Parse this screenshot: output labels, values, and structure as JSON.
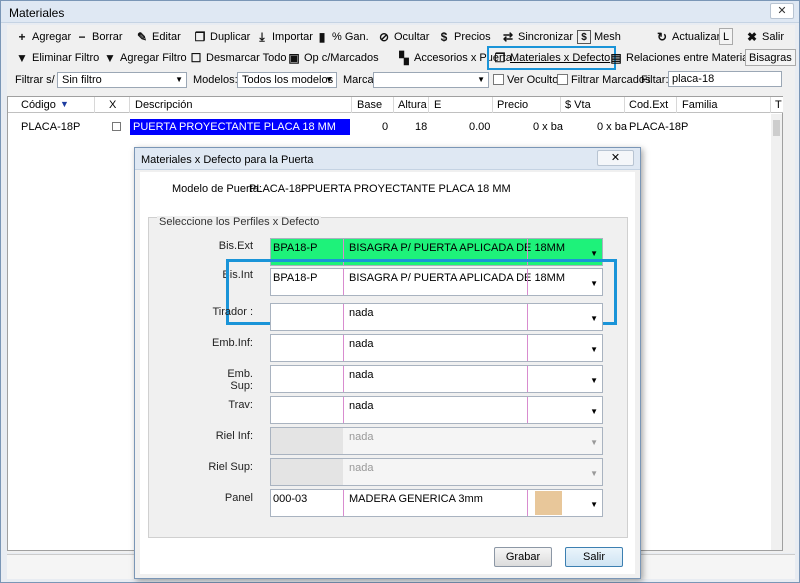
{
  "window": {
    "title": "Materiales",
    "close": "✕"
  },
  "toolbar1": [
    {
      "label": "Agregar",
      "icon": "plus-icon",
      "glyph": "+"
    },
    {
      "label": "Borrar",
      "icon": "minus-icon",
      "glyph": "−"
    },
    {
      "label": "Editar",
      "icon": "edit-icon",
      "glyph": "✎"
    },
    {
      "label": "Duplicar",
      "icon": "duplicate-icon",
      "glyph": "❐"
    },
    {
      "label": "Importar",
      "icon": "import-icon",
      "glyph": "⤓"
    },
    {
      "label": "% Gan.",
      "icon": "chart-icon",
      "glyph": "▮"
    },
    {
      "label": "Ocultar",
      "icon": "hide-icon",
      "glyph": "⊘"
    },
    {
      "label": "Precios",
      "icon": "dollar-icon",
      "glyph": "$"
    },
    {
      "label": "Sincronizar",
      "icon": "sync-icon",
      "glyph": "⇄"
    },
    {
      "label": "Mesh",
      "icon": "mesh-icon",
      "glyph": "$"
    },
    {
      "label": "Actualizar",
      "icon": "refresh-icon",
      "glyph": "↻"
    },
    {
      "label": "L",
      "icon": "",
      "glyph": ""
    },
    {
      "label": "Salir",
      "icon": "exit-icon",
      "glyph": "✖"
    }
  ],
  "toolbar2": [
    {
      "label": "Eliminar Filtro",
      "icon": "filter-remove-icon",
      "glyph": "▼"
    },
    {
      "label": "Agregar Filtro",
      "icon": "filter-add-icon",
      "glyph": "▼"
    },
    {
      "label": "Desmarcar Todo",
      "icon": "checkbox-icon",
      "glyph": "☐"
    },
    {
      "label": "Op c/Marcados",
      "icon": "ops-icon",
      "glyph": "▣"
    },
    {
      "label": "Accesorios x Puerta",
      "icon": "accessories-icon",
      "glyph": "▚"
    },
    {
      "label": "Materiales x Defecto",
      "icon": "materials-icon",
      "glyph": "❐"
    },
    {
      "label": "Relaciones entre Materiales",
      "icon": "relations-icon",
      "glyph": "▤"
    },
    {
      "label": "Bisagras",
      "icon": "",
      "glyph": ""
    }
  ],
  "filters": {
    "filtrar_label": "Filtrar s/ :",
    "filtrar_value": "Sin filtro",
    "modelos_label": "Modelos:",
    "modelos_value": "Todos los modelos",
    "marca_label": "Marca",
    "marca_value": "",
    "ver_ocultos": "Ver Ocultos",
    "filtrar_marcados": "Filtrar Marcados",
    "filtar_label": "Filtar:",
    "filtar_value": "placa-18"
  },
  "grid": {
    "columns": [
      "Código",
      "X",
      "Descripción",
      "Base",
      "Altura",
      "E",
      "Precio",
      "$ Vta",
      "Cod.Ext",
      "Familia",
      "T"
    ],
    "rows": [
      {
        "codigo": "PLACA-18P",
        "descripcion": "PUERTA PROYECTANTE PLACA 18 MM",
        "base": "0",
        "altura": "18",
        "e": "0.00",
        "precio": "0 x ba",
        "vta": "0 x ba",
        "codext": "PLACA-18P",
        "familia": ""
      }
    ]
  },
  "dialog": {
    "title": "Materiales x Defecto para la Puerta",
    "close": "✕",
    "modelo_label": "Modelo de Puerta:",
    "modelo_code": "PLACA-18P",
    "modelo_desc": "- PUERTA PROYECTANTE PLACA 18 MM",
    "group_label": "Seleccione los Perfiles x Defecto",
    "rows": [
      {
        "label": "Bis.Ext",
        "code": "BPA18-P",
        "desc": "BISAGRA P/ PUERTA APLICADA DE 18MM"
      },
      {
        "label": "Bis.Int",
        "code": "BPA18-P",
        "desc": "BISAGRA P/ PUERTA APLICADA DE 18MM"
      },
      {
        "label": "Tirador :",
        "code": "",
        "desc": "nada"
      },
      {
        "label": "Emb.Inf:",
        "code": "",
        "desc": "nada"
      },
      {
        "label": "Emb. Sup:",
        "code": "",
        "desc": "nada"
      },
      {
        "label": "Trav:",
        "code": "",
        "desc": "nada"
      },
      {
        "label": "Riel Inf:",
        "code": "",
        "desc": "nada"
      },
      {
        "label": "Riel Sup:",
        "code": "",
        "desc": "nada"
      },
      {
        "label": "Panel",
        "code": "000-03",
        "desc": "MADERA GENERICA 3mm"
      }
    ],
    "grabar": "Grabar",
    "salir": "Salir"
  },
  "colors": {
    "selected_row": "#0000ff",
    "highlight": "#1a94d8",
    "bisext_bg": "#1ef27a",
    "panel_swatch": "#e8c79a"
  }
}
